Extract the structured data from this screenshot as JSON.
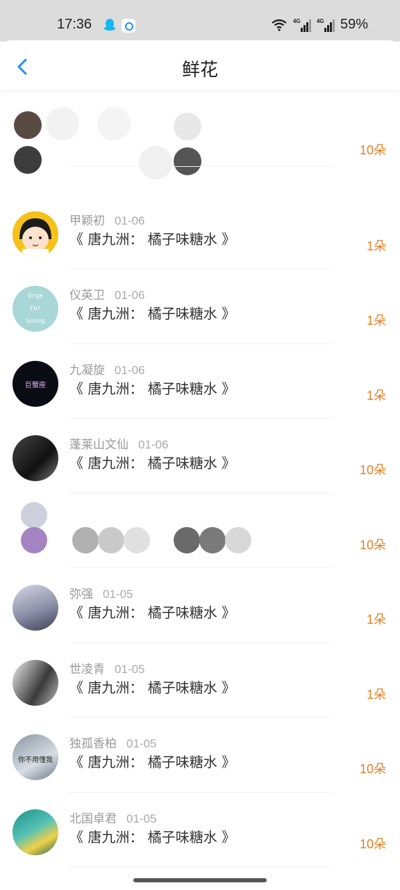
{
  "status": {
    "time": "17:36",
    "signal1": "4G",
    "signal2": "4G",
    "battery": "59%"
  },
  "header": {
    "title": "鲜花"
  },
  "rows": [
    {
      "name": "",
      "date": "",
      "book": "",
      "count": "10朵"
    },
    {
      "name": "甲颖初",
      "date": "01-06",
      "book": "《 唐九洲： 橘子味糖水 》",
      "count": "1朵"
    },
    {
      "name": "仪英卫",
      "date": "01-06",
      "book": "《 唐九洲： 橘子味糖水 》",
      "count": "1朵",
      "avatar_text": [
        "Urge",
        "For",
        "Going"
      ]
    },
    {
      "name": "九凝旋",
      "date": "01-06",
      "book": "《 唐九洲： 橘子味糖水 》",
      "count": "1朵",
      "avatar_text": [
        "巨蟹座"
      ]
    },
    {
      "name": "蓬莱山文仙",
      "date": "01-06",
      "book": "《 唐九洲： 橘子味糖水 》",
      "count": "10朵"
    },
    {
      "name": "",
      "date": "",
      "book": "",
      "count": "10朵"
    },
    {
      "name": "弥强",
      "date": "01-05",
      "book": "《 唐九洲： 橘子味糖水 》",
      "count": "1朵"
    },
    {
      "name": "世凌青",
      "date": "01-05",
      "book": "《 唐九洲： 橘子味糖水 》",
      "count": "1朵"
    },
    {
      "name": "独孤香柏",
      "date": "01-05",
      "book": "《 唐九洲： 橘子味糖水 》",
      "count": "10朵",
      "avatar_text": [
        "你不用懂我"
      ]
    },
    {
      "name": "北国卓君",
      "date": "01-05",
      "book": "《 唐九洲： 橘子味糖水 》",
      "count": "10朵"
    }
  ],
  "colors": {
    "accent_orange": "#e67e22",
    "back_blue": "#1a8fff"
  }
}
